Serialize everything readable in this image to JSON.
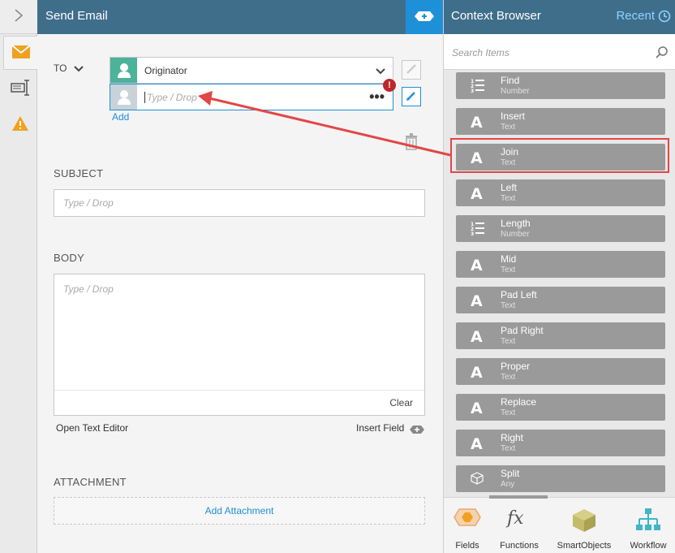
{
  "header": {
    "title": "Send Email"
  },
  "to_section": {
    "label": "TO",
    "recipient_value": "Originator",
    "new_recipient_placeholder": "Type / Drop",
    "error_badge": "!",
    "more_label": "•••",
    "add_link": "Add"
  },
  "subject": {
    "label": "SUBJECT",
    "placeholder": "Type / Drop"
  },
  "body": {
    "label": "BODY",
    "placeholder": "Type / Drop",
    "clear_label": "Clear",
    "open_text_editor": "Open Text Editor",
    "insert_field": "Insert Field"
  },
  "attachment": {
    "label": "ATTACHMENT",
    "add_label": "Add Attachment"
  },
  "context_browser": {
    "title": "Context Browser",
    "recent_label": "Recent",
    "search_placeholder": "Search Items",
    "items": [
      {
        "name": "Find",
        "type": "Number",
        "icon": "list-number-icon"
      },
      {
        "name": "Insert",
        "type": "Text",
        "icon": "text-a-icon"
      },
      {
        "name": "Join",
        "type": "Text",
        "icon": "text-a-icon"
      },
      {
        "name": "Left",
        "type": "Text",
        "icon": "text-a-icon"
      },
      {
        "name": "Length",
        "type": "Number",
        "icon": "list-number-icon"
      },
      {
        "name": "Mid",
        "type": "Text",
        "icon": "text-a-icon"
      },
      {
        "name": "Pad Left",
        "type": "Text",
        "icon": "text-a-icon"
      },
      {
        "name": "Pad Right",
        "type": "Text",
        "icon": "text-a-icon"
      },
      {
        "name": "Proper",
        "type": "Text",
        "icon": "text-a-icon"
      },
      {
        "name": "Replace",
        "type": "Text",
        "icon": "text-a-icon"
      },
      {
        "name": "Right",
        "type": "Text",
        "icon": "text-a-icon"
      },
      {
        "name": "Split",
        "type": "Any",
        "icon": "cube-outline-icon"
      }
    ],
    "highlighted_item": "Join",
    "tabs": [
      {
        "label": "Fields",
        "icon": "fields-hexagon-icon"
      },
      {
        "label": "Functions",
        "icon": "fx-icon"
      },
      {
        "label": "SmartObjects",
        "icon": "smartobject-cube-icon"
      },
      {
        "label": "Workflow",
        "icon": "workflow-tree-icon"
      }
    ]
  },
  "colors": {
    "header": "#3f6e8b",
    "accent_blue": "#1e90d8",
    "highlight_red": "#e34646",
    "item_gray": "#9a9a9a",
    "recipient_green": "#4db29a"
  }
}
